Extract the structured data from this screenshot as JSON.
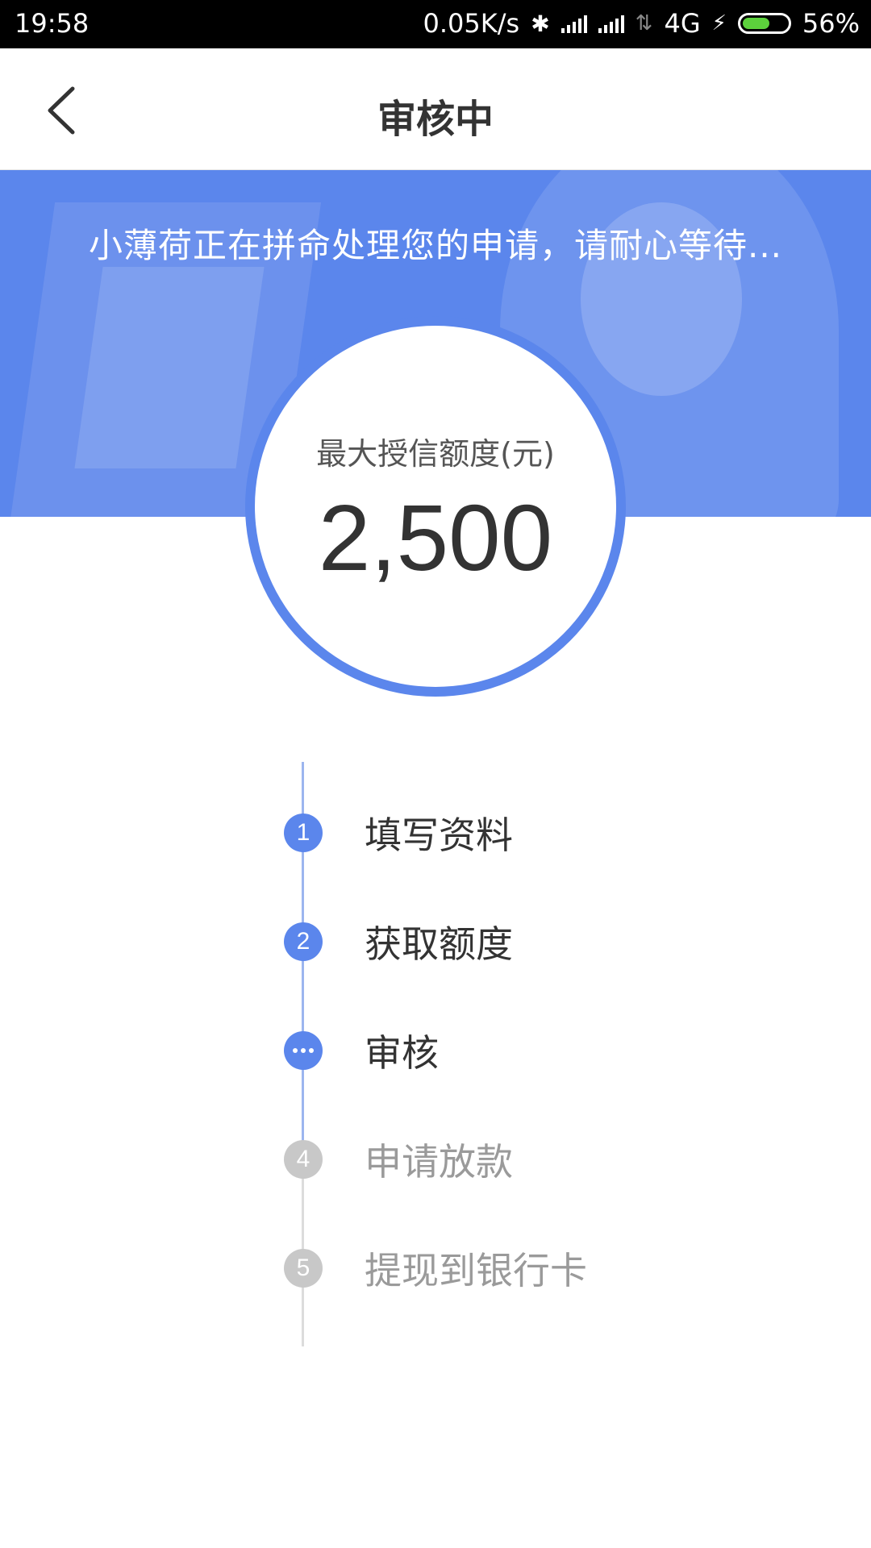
{
  "status_bar": {
    "time": "19:58",
    "network_speed": "0.05K/s",
    "network_type": "4G",
    "battery": "56%",
    "battery_level": 0.56,
    "icons": [
      "bluetooth-icon",
      "signal-icon",
      "signal-icon",
      "data-arrows-icon",
      "charging-icon",
      "battery-icon"
    ]
  },
  "header": {
    "title": "审核中",
    "back_icon": "chevron-left-icon"
  },
  "banner": {
    "message": "小薄荷正在拼命处理您的申请，请耐心等待..."
  },
  "credit": {
    "label": "最大授信额度(元)",
    "amount": "2,500"
  },
  "steps": [
    {
      "marker": "1",
      "label": "填写资料",
      "state": "done"
    },
    {
      "marker": "2",
      "label": "获取额度",
      "state": "done"
    },
    {
      "marker": "",
      "label": "审核",
      "state": "in-progress"
    },
    {
      "marker": "4",
      "label": "申请放款",
      "state": "pending"
    },
    {
      "marker": "5",
      "label": "提现到银行卡",
      "state": "pending"
    }
  ],
  "colors": {
    "accent": "#5b86ec",
    "pending": "#c8c8c8",
    "text_dark": "#333333",
    "text_muted": "#9a9a9a"
  }
}
